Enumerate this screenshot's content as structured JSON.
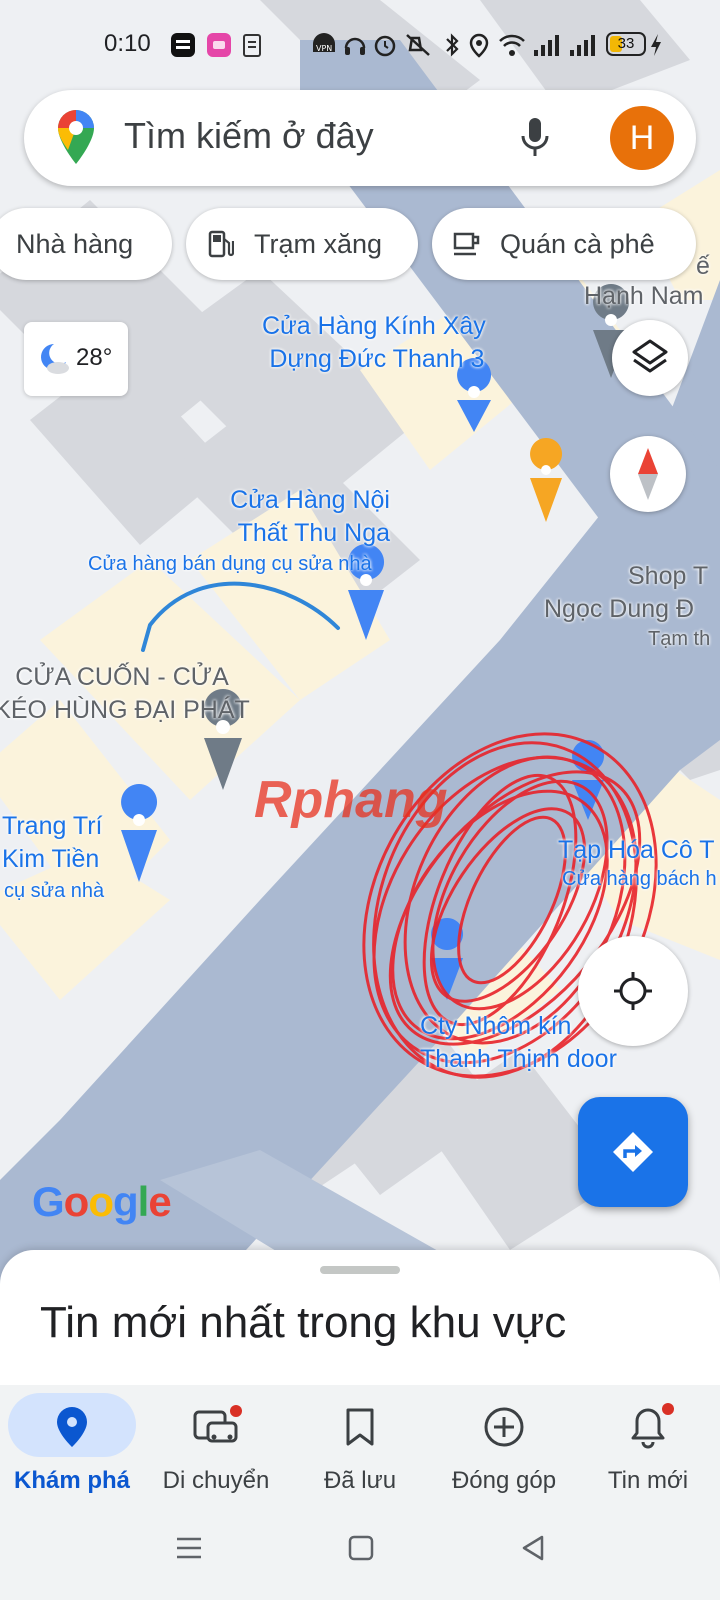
{
  "status_bar": {
    "time": "0:10",
    "battery_level": "33",
    "icons": [
      "baomoi-app-icon",
      "lazada-app-icon",
      "clipboard-icon",
      "vpn-icon",
      "headset-icon",
      "alarm-icon",
      "mute-icon",
      "bluetooth-icon",
      "location-icon",
      "wifi-icon",
      "signal-icon",
      "signal-icon",
      "battery-icon",
      "charging-icon"
    ]
  },
  "search": {
    "placeholder": "Tìm kiếm ở đây",
    "avatar_letter": "H"
  },
  "chips": [
    {
      "label": "Nhà hàng",
      "icon": "restaurant-icon"
    },
    {
      "label": "Trạm xăng",
      "icon": "gas-station-icon"
    },
    {
      "label": "Quán cà phê",
      "icon": "coffee-icon"
    }
  ],
  "weather": {
    "temperature": "28°",
    "icon": "moon-cloud-icon"
  },
  "map_labels": {
    "p1_line1": "Cửa Hàng Kính Xây",
    "p1_line2": "Dựng Đức Thanh 3",
    "p2_line1": "Cửa Hàng Nội",
    "p2_line2": "Thất Thu Nga",
    "p2_sub": "Cửa hàng bán dụng cụ sửa nhà",
    "p3_line1": "CỬA CUỐN - CỬA",
    "p3_line2": "KÉO HÙNG ĐẠI PHÁT",
    "p4_line1": "Trang Trí",
    "p4_line2": "Kim Tiền",
    "p4_sub": "cụ sửa nhà",
    "p5_line1": "Shop T",
    "p5_line2": "Ngọc Dung Đ",
    "p5_sub": "Tạm th",
    "p6_line1": "Tạp Hóa Cô T",
    "p6_sub": "Cửa hàng bách h",
    "p7_line1": "Cty Nhôm kín",
    "p7_line2": "Thanh Thịnh door",
    "p8_line1": "Hạnh Nam",
    "p8_top": "ế"
  },
  "google_logo": {
    "G": "G",
    "o1": "o",
    "o2": "o",
    "g": "g",
    "l": "l",
    "e": "e"
  },
  "watermark": "Rphang",
  "sheet": {
    "title": "Tin mới nhất trong khu vực"
  },
  "bottom_nav": [
    {
      "label": "Khám phá",
      "icon": "explore-pin-icon",
      "active": true
    },
    {
      "label": "Di chuyển",
      "icon": "commute-icon",
      "badge": true
    },
    {
      "label": "Đã lưu",
      "icon": "bookmark-icon"
    },
    {
      "label": "Đóng góp",
      "icon": "add-circle-icon"
    },
    {
      "label": "Tin mới",
      "icon": "bell-icon",
      "badge": true
    }
  ],
  "colors": {
    "accent": "#1a73e8",
    "road": "#aab9d1",
    "block": "#d4d6db",
    "parcel": "#fcf4dc",
    "scribble": "#e8232a",
    "annotation_stroke": "#2f86d8",
    "avatar": "#e8710a"
  }
}
